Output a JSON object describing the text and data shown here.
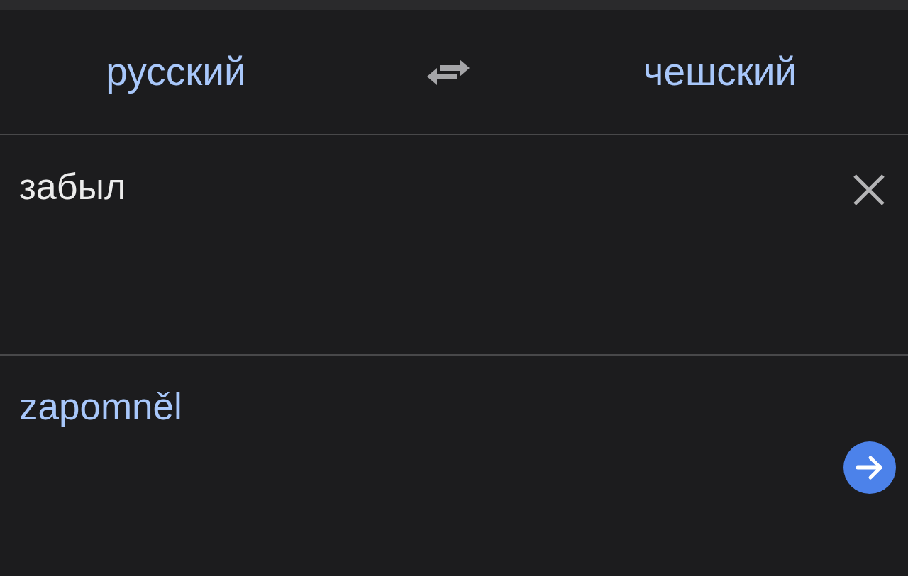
{
  "languages": {
    "source": "русский",
    "target": "чешский"
  },
  "input": {
    "value": "забыл"
  },
  "output": {
    "text": "zapomněl"
  }
}
